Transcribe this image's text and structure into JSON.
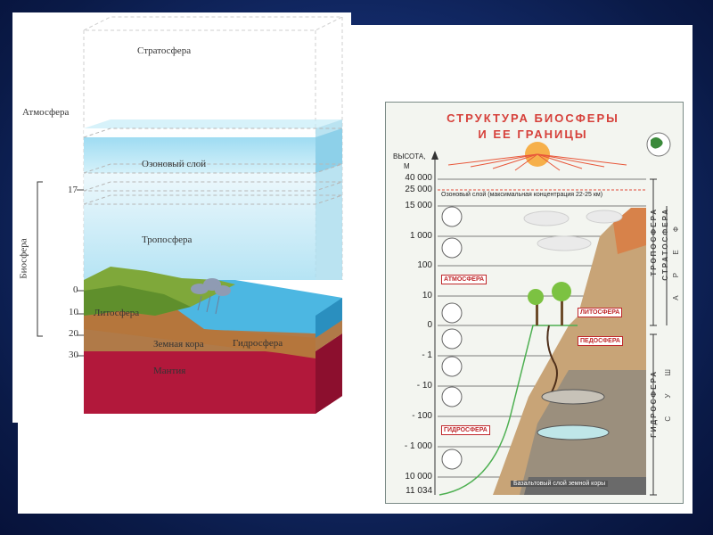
{
  "left_diagram": {
    "layers": {
      "stratosphere": "Стратосфера",
      "atmosphere": "Атмосфера",
      "ozone": "Озоновый слой",
      "troposphere": "Тропосфера",
      "biosphere": "Биосфера",
      "lithosphere": "Литосфера",
      "crust": "Земная кора",
      "hydrosphere": "Гидросфера",
      "mantle": "Мантия"
    },
    "scale": [
      "17",
      "0",
      "10",
      "20",
      "30"
    ]
  },
  "poster": {
    "title_line1": "СТРУКТУРА  БИОСФЕРЫ",
    "title_line2": "И  ЕЕ  ГРАНИЦЫ",
    "axis_label_1": "ВЫСОТА,",
    "axis_label_2": "М",
    "ticks": [
      "40 000",
      "25 000",
      "15 000",
      "1 000",
      "100",
      "10",
      "0",
      "- 1",
      "- 10",
      "- 100",
      "- 1 000",
      "10 000",
      "11 034"
    ],
    "ozone_caption": "Озоновый слой (максимальная концентрация 22-25 км)",
    "tags": {
      "atmosphere": "АТМОСФЕРА",
      "lithosphere": "ЛИТОСФЕРА",
      "pedosphere": "ПЕДОСФЕРА",
      "hydrosphere": "ГИДРОСФЕРА"
    },
    "basalt_caption": "Базальтовый слой земной коры",
    "side_labels": {
      "stratosphere": "СТРАТОСФЕРА",
      "troposphere": "ТРОПОСФЕРА",
      "hydrosphere": "ГИДРОСФЕРА",
      "atmosphere_letters": "А Р Е Ф",
      "land_letters": "С У Ш"
    }
  },
  "colors": {
    "sky": "#b8e6f4",
    "water": "#38a9dc",
    "land": "#b86f38",
    "mantle": "#b2183b",
    "title": "#d6403a",
    "tag": "#c0282b"
  }
}
